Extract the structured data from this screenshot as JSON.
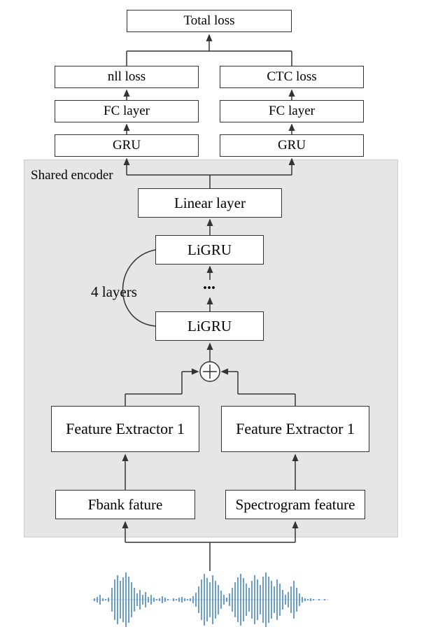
{
  "top": {
    "total_loss": "Total loss",
    "left": {
      "nll": "nll loss",
      "fc": "FC layer",
      "gru": "GRU"
    },
    "right": {
      "ctc": "CTC loss",
      "fc": "FC layer",
      "gru": "GRU"
    }
  },
  "encoder": {
    "label": "Shared encoder",
    "linear": "Linear layer",
    "ligru_top": "LiGRU",
    "dots": "...",
    "ligru_bottom": "LiGRU",
    "layers_note": "4 layers",
    "fe1_left": "Feature Extractor 1",
    "fe1_right": "Feature Extractor 1",
    "fbank": "Fbank fature",
    "spec": "Spectrogram feature"
  },
  "icons": {
    "plus": "circled-plus"
  }
}
